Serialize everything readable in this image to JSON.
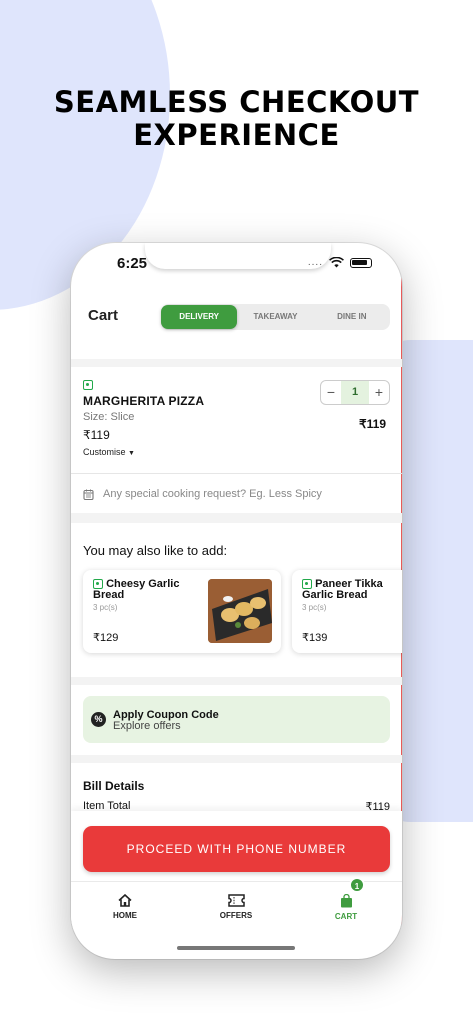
{
  "page": {
    "headline_line1": "SEAMLESS CHECKOUT",
    "headline_line2": "EXPERIENCE"
  },
  "status_bar": {
    "time": "6:25",
    "signal": "....",
    "wifi_icon": "wifi-icon",
    "battery_icon": "battery-icon"
  },
  "header": {
    "title": "Cart",
    "tabs": [
      {
        "label": "DELIVERY",
        "selected": true
      },
      {
        "label": "TAKEAWAY",
        "selected": false
      },
      {
        "label": "DINE IN",
        "selected": false
      }
    ]
  },
  "cart_item": {
    "name": "MARGHERITA PIZZA",
    "size": "Size: Slice",
    "price": "₹119",
    "customise": "Customise",
    "quantity": "1",
    "minus": "−",
    "plus": "+",
    "line_total": "₹119",
    "veg_icon": "veg-indicator-icon"
  },
  "special_request": {
    "placeholder": "Any special cooking request? Eg. Less Spicy",
    "icon": "notepad-icon"
  },
  "suggestions": {
    "heading": "You may also like to add:",
    "items": [
      {
        "name": "Cheesy Garlic Bread",
        "pieces": "3 pc(s)",
        "price": "₹129"
      },
      {
        "name": "Paneer Tikka Garlic Bread",
        "pieces": "3 pc(s)",
        "price": "₹139"
      }
    ]
  },
  "coupon": {
    "title": "Apply Coupon Code",
    "subtitle": "Explore offers",
    "icon": "discount-icon"
  },
  "bill": {
    "title": "Bill Details",
    "item_total_label": "Item Total",
    "item_total_value": "₹119"
  },
  "cta": {
    "label": "PROCEED WITH PHONE NUMBER"
  },
  "tabbar": {
    "items": [
      {
        "label": "HOME",
        "icon": "home-icon"
      },
      {
        "label": "OFFERS",
        "icon": "ticket-icon"
      },
      {
        "label": "CART",
        "icon": "cart-bag-icon",
        "badge": "1"
      }
    ]
  },
  "colors": {
    "accent_green": "#3f9c3f",
    "cta_red": "#e93a3a",
    "coupon_bg": "#e7f3e2",
    "blob": "#dfe5fc"
  }
}
